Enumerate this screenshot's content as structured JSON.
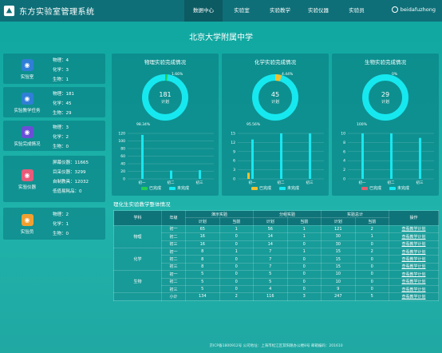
{
  "app": {
    "title": "东方实验室管理系统"
  },
  "nav": {
    "items": [
      "数据中心",
      "实验室",
      "实验教学",
      "实验仪器",
      "实验员"
    ],
    "active": 0
  },
  "user": {
    "name": "beidafuzhong"
  },
  "school": "北京大学附属中学",
  "left_cards": [
    {
      "label": "实验室",
      "icon": "lab-icon",
      "color": "#2f7fd6",
      "rows": [
        "物理：4",
        "化学：3",
        "生物：1"
      ]
    },
    {
      "label": "实验教学任务",
      "icon": "clock-icon",
      "color": "#2f7fd6",
      "rows": [
        "物理：181",
        "化学：45",
        "生物：29"
      ]
    },
    {
      "label": "实验完成情况",
      "icon": "user-icon",
      "color": "#6a4fd6",
      "rows": [
        "物理：3",
        "化学：2",
        "生物：0"
      ]
    },
    {
      "label": "实验仪器",
      "icon": "flask-icon",
      "color": "#e85b7a",
      "rows": [
        "屏幕仪器：11665",
        "目采仪器：3299",
        "自制教具：12032",
        "低值易耗品：0"
      ]
    },
    {
      "label": "实验员",
      "icon": "person-icon",
      "color": "#f0a030",
      "rows": [
        "物理：2",
        "化学：1",
        "生物：0"
      ]
    }
  ],
  "panels": [
    {
      "title": "物理实验完成情况",
      "total": "181",
      "unit": "计划",
      "done_pct_label": "1.66%",
      "undone_pct_label": "98.34%",
      "done_frac": 0.0166,
      "chart_data": {
        "type": "bar",
        "categories": [
          "初一",
          "初二",
          "初三"
        ],
        "ylim": [
          0,
          120
        ],
        "ticks": [
          "120",
          "100",
          "80",
          "60",
          "40",
          "20",
          "0"
        ],
        "series": [
          {
            "name": "已完成",
            "values": [
              0,
              0,
              0
            ]
          },
          {
            "name": "未完成",
            "values": [
              116,
              22,
              23
            ]
          }
        ]
      }
    },
    {
      "title": "化学实验完成情况",
      "total": "45",
      "unit": "计划",
      "done_pct_label": "4.44%",
      "undone_pct_label": "95.56%",
      "done_frac": 0.0444,
      "chart_data": {
        "type": "bar",
        "categories": [
          "初一",
          "初二",
          "初三"
        ],
        "ylim": [
          0,
          15
        ],
        "ticks": [
          "15",
          "12",
          "9",
          "6",
          "3",
          "0"
        ],
        "series": [
          {
            "name": "已完成",
            "values": [
              2,
              0,
              0
            ]
          },
          {
            "name": "未完成",
            "values": [
              13,
              15,
              15
            ]
          }
        ]
      }
    },
    {
      "title": "生物实验完成情况",
      "total": "29",
      "unit": "计划",
      "done_pct_label": "0%",
      "undone_pct_label": "100%",
      "done_frac": 0,
      "chart_data": {
        "type": "bar",
        "categories": [
          "初一",
          "初二",
          "初三"
        ],
        "ylim": [
          0,
          10
        ],
        "ticks": [
          "10",
          "8",
          "6",
          "4",
          "2",
          "0"
        ],
        "series": [
          {
            "name": "已完成",
            "values": [
              0,
              0,
              0
            ]
          },
          {
            "name": "未完成",
            "values": [
              10,
              10,
              9
            ]
          }
        ]
      }
    }
  ],
  "legend": {
    "done": "已完成",
    "undone": "未完成",
    "done_colors": [
      "#22cc55",
      "#f0c030",
      "#e06070"
    ],
    "undone_color": "#16e8f0"
  },
  "table": {
    "title": "理化生实验教学整体情况",
    "h_subject": "学科",
    "h_grade": "年级",
    "h_demo": "演示实验",
    "h_group": "分组实验",
    "h_total": "实验总计",
    "h_op": "操作",
    "h_plan": "计划",
    "h_cur": "当前",
    "rows": [
      {
        "subject": "物理",
        "grade": "初一",
        "v": [
          "65",
          "1",
          "56",
          "1",
          "121",
          "2"
        ]
      },
      {
        "subject": "",
        "grade": "初二",
        "v": [
          "16",
          "0",
          "14",
          "1",
          "30",
          "1"
        ]
      },
      {
        "subject": "",
        "grade": "初三",
        "v": [
          "16",
          "0",
          "14",
          "0",
          "30",
          "0"
        ]
      },
      {
        "subject": "化学",
        "grade": "初一",
        "v": [
          "8",
          "1",
          "7",
          "1",
          "15",
          "2"
        ]
      },
      {
        "subject": "",
        "grade": "初二",
        "v": [
          "8",
          "0",
          "7",
          "0",
          "15",
          "0"
        ]
      },
      {
        "subject": "",
        "grade": "初三",
        "v": [
          "8",
          "0",
          "7",
          "0",
          "15",
          "0"
        ]
      },
      {
        "subject": "生物",
        "grade": "初一",
        "v": [
          "5",
          "0",
          "5",
          "0",
          "10",
          "0"
        ]
      },
      {
        "subject": "",
        "grade": "初二",
        "v": [
          "5",
          "0",
          "5",
          "0",
          "10",
          "0"
        ]
      },
      {
        "subject": "",
        "grade": "初三",
        "v": [
          "5",
          "0",
          "4",
          "0",
          "9",
          "0"
        ]
      },
      {
        "subject": "",
        "grade": "小计",
        "v": [
          "134",
          "2",
          "116",
          "3",
          "247",
          "5"
        ]
      }
    ],
    "link": "查看教学计划"
  },
  "footer": "京ICP备1800912号 公司地址：上海市松江区茸阳路办公楼8号 邮箱编码：201610"
}
